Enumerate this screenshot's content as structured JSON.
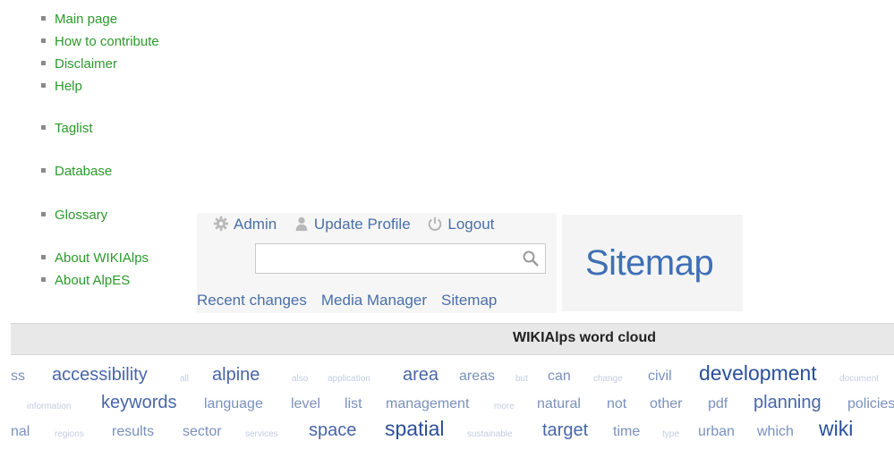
{
  "nav": {
    "items": [
      {
        "label": "Main page"
      },
      {
        "label": "How to contribute"
      },
      {
        "label": "Disclaimer"
      },
      {
        "label": "Help"
      },
      {
        "label": "Taglist"
      },
      {
        "label": "Database"
      },
      {
        "label": "Glossary"
      },
      {
        "label": "About WIKIAlps"
      },
      {
        "label": "About AlpES"
      }
    ]
  },
  "user": {
    "admin": "Admin",
    "update_profile": "Update Profile",
    "logout": "Logout"
  },
  "search": {
    "value": "",
    "placeholder": ""
  },
  "tools": {
    "recent_changes": "Recent changes",
    "media_manager": "Media Manager",
    "sitemap": "Sitemap"
  },
  "page": {
    "title": "Sitemap"
  },
  "wordcloud": {
    "title": "WIKIAlps word cloud",
    "rows": [
      [
        {
          "text": "ss",
          "size": 2
        },
        {
          "text": "accessibility",
          "size": 3
        },
        {
          "text": "all",
          "size": 1
        },
        {
          "text": "alpine",
          "size": 3
        },
        {
          "text": "also",
          "size": 1
        },
        {
          "text": "application",
          "size": 1
        },
        {
          "text": "area",
          "size": 3
        },
        {
          "text": "areas",
          "size": 2
        },
        {
          "text": "but",
          "size": 1
        },
        {
          "text": "can",
          "size": 2
        },
        {
          "text": "change",
          "size": 1
        },
        {
          "text": "civil",
          "size": 2
        },
        {
          "text": "development",
          "size": 4
        },
        {
          "text": "document",
          "size": 1
        }
      ],
      [
        {
          "text": "information",
          "size": 1
        },
        {
          "text": "keywords",
          "size": 3
        },
        {
          "text": "language",
          "size": 2
        },
        {
          "text": "level",
          "size": 2
        },
        {
          "text": "list",
          "size": 2
        },
        {
          "text": "management",
          "size": 2
        },
        {
          "text": "more",
          "size": 1
        },
        {
          "text": "natural",
          "size": 2
        },
        {
          "text": "not",
          "size": 2
        },
        {
          "text": "other",
          "size": 2
        },
        {
          "text": "pdf",
          "size": 2
        },
        {
          "text": "planning",
          "size": 3
        },
        {
          "text": "policies",
          "size": 2
        }
      ],
      [
        {
          "text": "nal",
          "size": 2
        },
        {
          "text": "regions",
          "size": 1
        },
        {
          "text": "results",
          "size": 2
        },
        {
          "text": "sector",
          "size": 2
        },
        {
          "text": "services",
          "size": 1
        },
        {
          "text": "space",
          "size": 3
        },
        {
          "text": "spatial",
          "size": 4
        },
        {
          "text": "sustainable",
          "size": 1
        },
        {
          "text": "target",
          "size": 3
        },
        {
          "text": "time",
          "size": 2
        },
        {
          "text": "type",
          "size": 1
        },
        {
          "text": "urban",
          "size": 2
        },
        {
          "text": "which",
          "size": 2
        },
        {
          "text": "wiki",
          "size": 4
        }
      ]
    ]
  },
  "icons": {
    "admin": "gear-icon",
    "update_profile": "user-icon",
    "logout": "power-icon",
    "search": "search-icon"
  },
  "colors": {
    "nav_link": "#2a9a2a",
    "link": "#4a6fa8",
    "title": "#3f6fb6"
  }
}
